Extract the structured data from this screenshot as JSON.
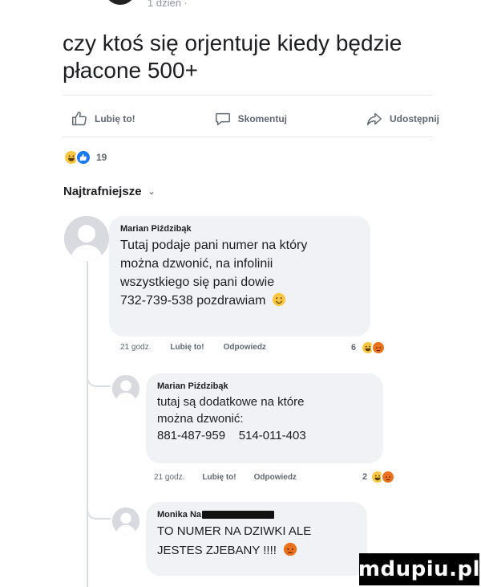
{
  "post": {
    "meta": "1 dzień · ",
    "text_line1": "czy ktoś się orjentuje kiedy będzie",
    "text_line2": "płacone 500+"
  },
  "actions": {
    "like": "Lubię to!",
    "comment": "Skomentuj",
    "share": "Udostępnij"
  },
  "reactions": {
    "count": "19"
  },
  "sort": {
    "label": "Najtrafniejsze"
  },
  "comments": [
    {
      "author": "Marian Piździbąk",
      "lines": [
        "Tutaj podaje pani numer na który",
        "można dzwonić, na infolinii",
        "wszystkiego się pani dowie",
        "732-739-538 pozdrawiam"
      ],
      "time": "21 godz.",
      "like": "Lubię to!",
      "reply": "Odpowiedz",
      "reaction_count": "6"
    },
    {
      "author": "Marian Piździbąk",
      "lines": [
        "tutaj są dodatkowe na które",
        "można dzwonić:",
        "881-487-959    514-011-403"
      ],
      "time": "21 godz.",
      "like": "Lubię to!",
      "reply": "Odpowiedz",
      "reaction_count": "2"
    },
    {
      "author": "Monika Na",
      "lines": [
        "TO NUMER NA DZIWKI ALE",
        "JESTES ZJEBANY !!!!"
      ]
    }
  ],
  "watermark": "mdupiu.pl",
  "colors": {
    "like_blue": "#1877f2",
    "haha_yellow": "#f7c744",
    "angry_orange": "#e9711c",
    "bubble_bg": "#f0f2f5"
  }
}
